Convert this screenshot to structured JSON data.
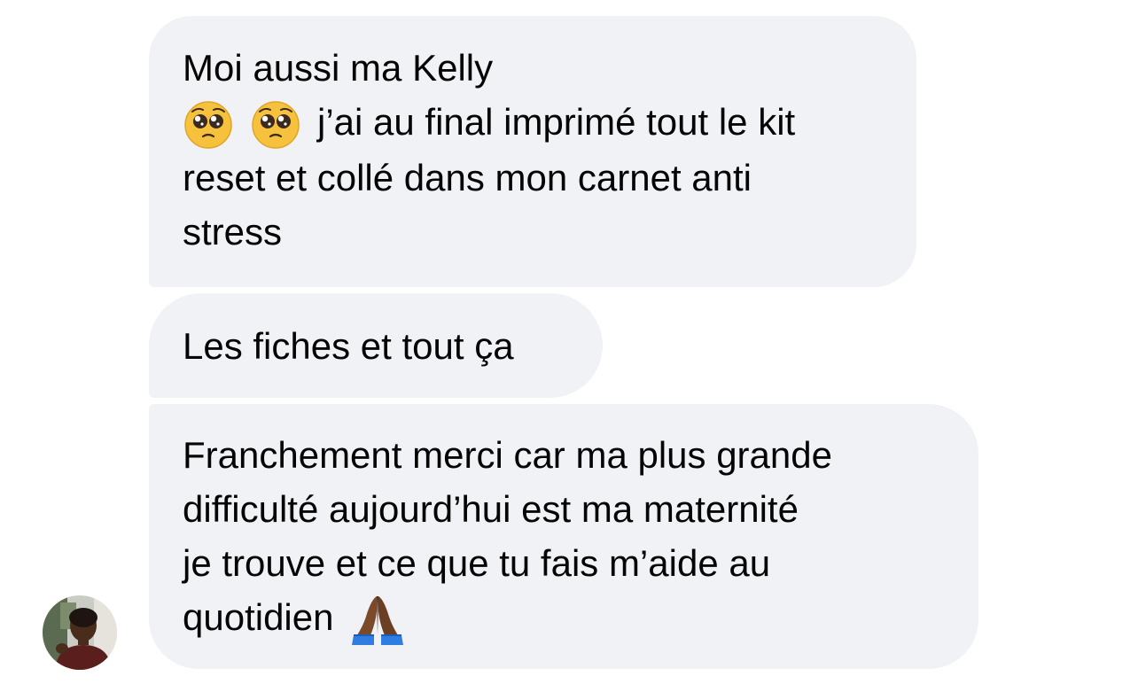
{
  "messages": [
    {
      "lines": {
        "l1": "Moi aussi ma Kelly",
        "l2": "j’ai au final imprimé tout le kit",
        "l3": "reset et collé dans mon carnet anti",
        "l4": "stress"
      },
      "emojis": [
        "pleading-face-icon",
        "pleading-face-icon"
      ]
    },
    {
      "lines": {
        "l1": "Les fiches et tout ça"
      }
    },
    {
      "lines": {
        "l1": "Franchement merci car ma plus grande",
        "l2": "difficulté aujourd’hui est ma maternité",
        "l3": "je trouve et ce que tu fais m’aide au",
        "l4": "quotidien"
      },
      "emojis": [
        "folded-hands-icon"
      ]
    }
  ],
  "colors": {
    "bubble_bg": "#f1f2f6",
    "text": "#050505",
    "emoji_yellow": "#f6c23e",
    "emoji_skin": "#7a4a2b",
    "sleeve_blue": "#2f7de1"
  }
}
